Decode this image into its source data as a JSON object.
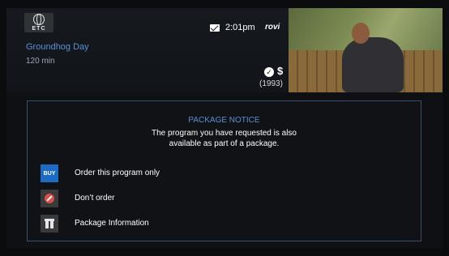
{
  "header": {
    "logo_text": "ETC",
    "title": "Groundhog Day",
    "duration": "120 min",
    "time": "2:01pm",
    "provider": "rovi",
    "price_symbol": "$",
    "year": "(1993)"
  },
  "notice": {
    "heading": "PACKAGE NOTICE",
    "line1": "The program you have requested is also",
    "line2": "available as part of a package."
  },
  "options": [
    {
      "icon": "BUY",
      "label": "Order this program only"
    },
    {
      "icon": "no-icon",
      "label": "Don’t order"
    },
    {
      "icon": "gift-icon",
      "label": "Package Information"
    }
  ]
}
